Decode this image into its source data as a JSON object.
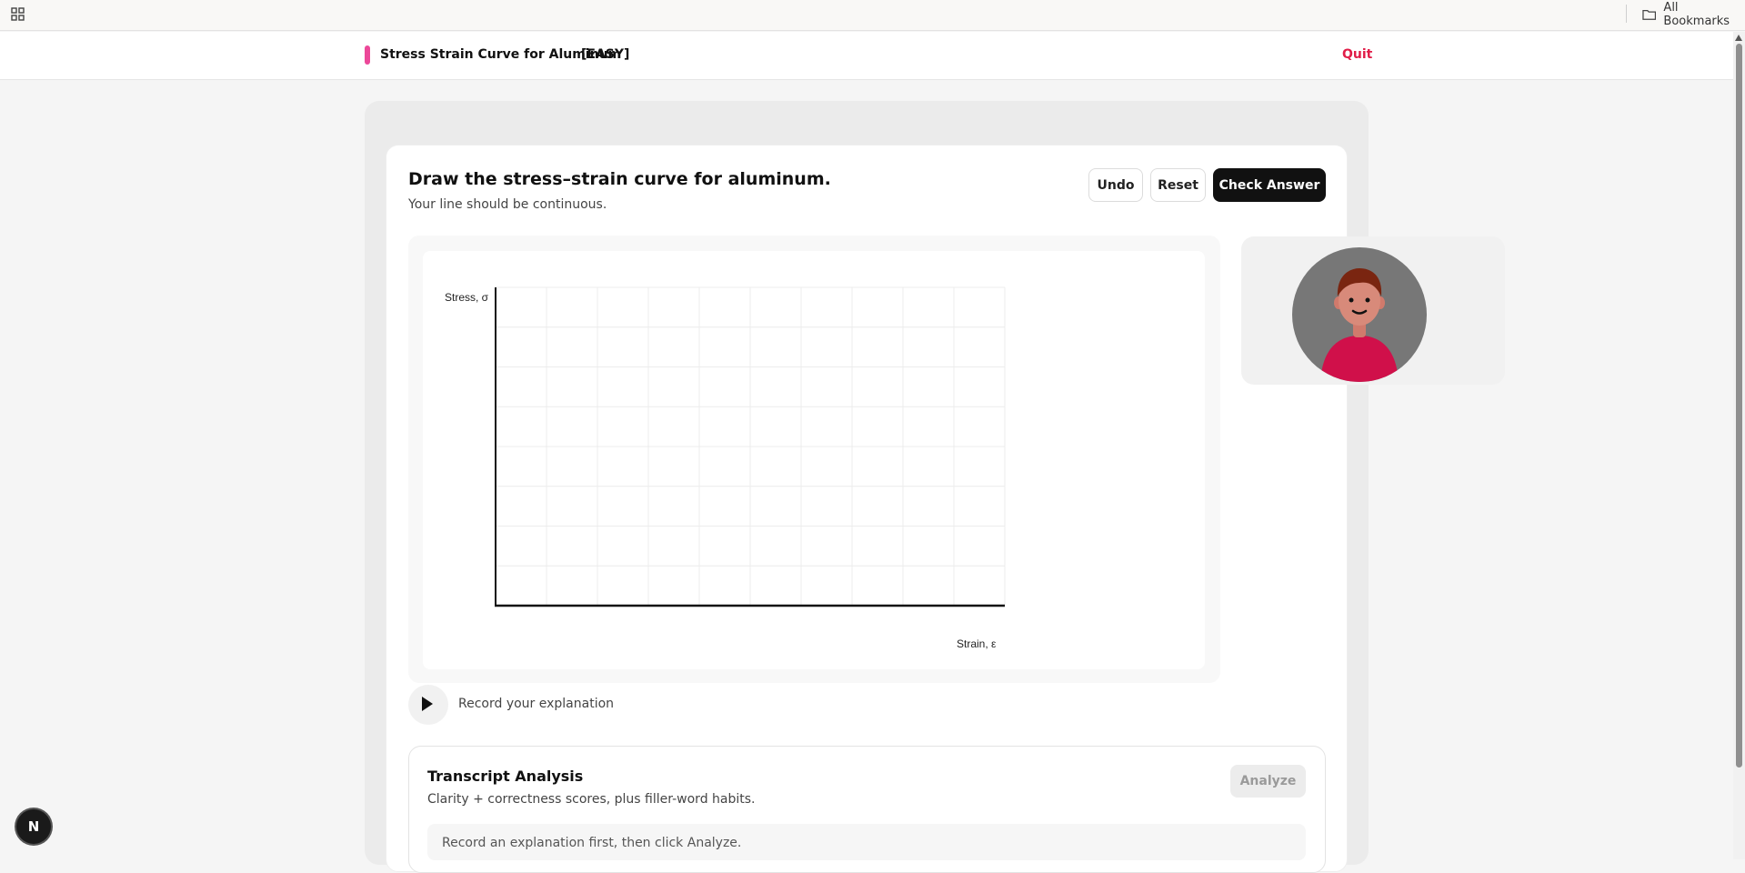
{
  "browser": {
    "bookmarks_label": "All Bookmarks",
    "icons": {
      "apps": "apps-grid-icon",
      "folder": "folder-icon"
    }
  },
  "header": {
    "title": "Stress Strain Curve for Aluminum",
    "difficulty": "[EASY]",
    "quit_label": "Quit",
    "accent_color": "#ec4899",
    "quit_color": "#e11d48"
  },
  "task": {
    "title": "Draw the stress–strain curve for aluminum.",
    "subtitle": "Your line should be continuous."
  },
  "toolbar": {
    "undo_label": "Undo",
    "reset_label": "Reset",
    "check_label": "Check Answer"
  },
  "canvas": {
    "ylabel": "Stress, σ",
    "xlabel": "Strain, ε",
    "grid_columns": 10,
    "grid_rows": 8
  },
  "record": {
    "label": "Record your explanation",
    "icon": "play-icon"
  },
  "transcript": {
    "title": "Transcript Analysis",
    "subtitle": "Clarity + correctness scores, plus filler-word habits.",
    "analyze_label": "Analyze",
    "empty_message": "Record an explanation first, then click Analyze."
  },
  "badge": {
    "letter": "N"
  }
}
